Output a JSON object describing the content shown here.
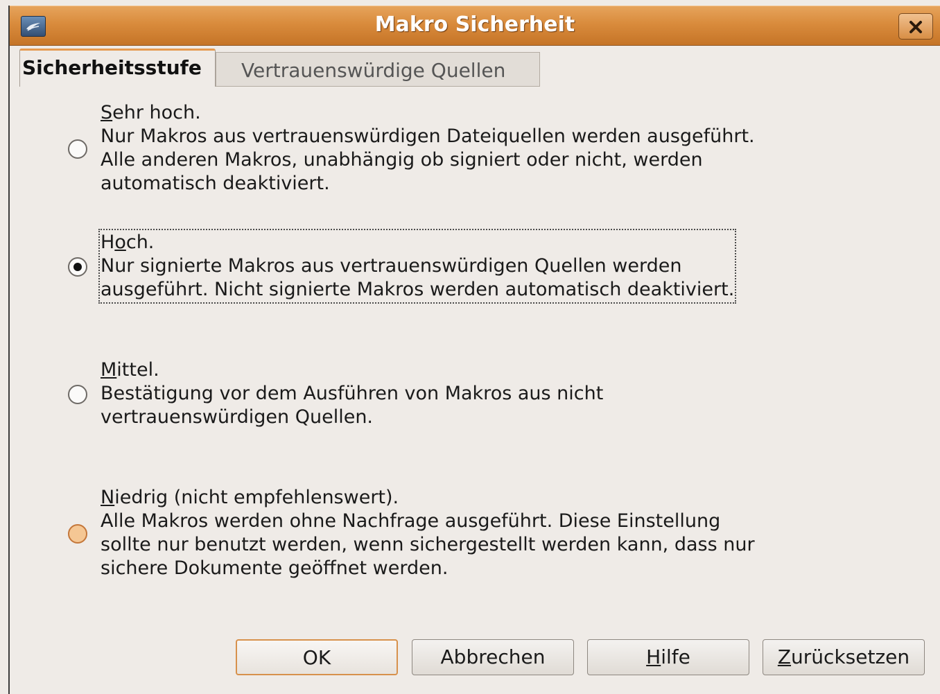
{
  "window": {
    "title": "Makro Sicherheit",
    "accent": "#d98b3c"
  },
  "tabs": [
    {
      "label": "Sicherheitsstufe",
      "active": true
    },
    {
      "label": "Vertrauenswürdige Quellen",
      "active": false
    }
  ],
  "options": [
    {
      "mnemonic": "S",
      "heading_rest": "ehr hoch.",
      "lines": [
        "Nur Makros aus vertrauenswürdigen Dateiquellen werden ausgeführt.",
        "Alle anderen Makros, unabhängig ob signiert oder nicht, werden",
        "automatisch deaktiviert."
      ],
      "selected": false
    },
    {
      "heading_pre": "H",
      "mnemonic": "o",
      "heading_rest": "ch.",
      "lines": [
        "Nur signierte Makros aus vertrauenswürdigen Quellen werden",
        "ausgeführt. Nicht signierte Makros werden automatisch deaktiviert."
      ],
      "selected": true
    },
    {
      "mnemonic": "M",
      "heading_rest": "ittel.",
      "lines": [
        "Bestätigung vor dem Ausführen von Makros aus nicht",
        "vertrauenswürdigen Quellen."
      ],
      "selected": false
    },
    {
      "mnemonic": "N",
      "heading_rest": "iedrig (nicht empfehlenswert).",
      "lines": [
        "Alle Makros werden ohne Nachfrage ausgeführt. Diese Einstellung",
        "sollte nur benutzt werden, wenn sichergestellt werden kann, dass nur",
        "sichere Dokumente geöffnet werden."
      ],
      "selected": false
    }
  ],
  "buttons": {
    "ok": "OK",
    "cancel": "Abbrechen",
    "help_mnemonic": "H",
    "help_rest": "ilfe",
    "reset_mnemonic": "Z",
    "reset_rest": "urücksetzen"
  }
}
